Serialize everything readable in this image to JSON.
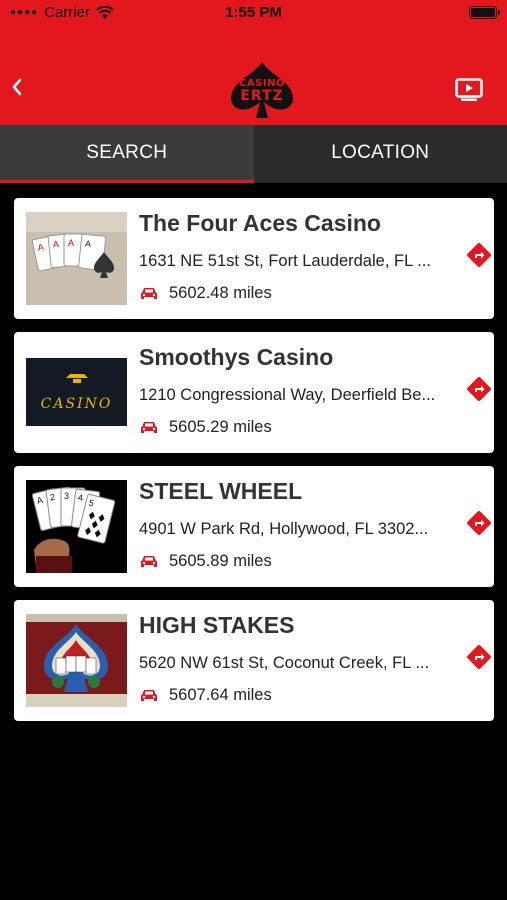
{
  "status_bar": {
    "carrier": "Carrier",
    "time": "1:55 PM"
  },
  "header": {
    "logo_line1": "CASINO",
    "logo_line2": "ERTZ",
    "back_icon": "chevron-left-icon",
    "right_icon": "tv-play-icon"
  },
  "tabs": [
    {
      "label": "SEARCH",
      "active": true
    },
    {
      "label": "LOCATION",
      "active": false
    }
  ],
  "casinos": [
    {
      "name": "The Four Aces Casino",
      "address": "1631 NE 51st St, Fort Lauderdale, FL ...",
      "distance": "5602.48 miles"
    },
    {
      "name": "Smoothys Casino",
      "address": "1210 Congressional Way, Deerfield Be...",
      "distance": "5605.29 miles",
      "thumb_text": "CASINO"
    },
    {
      "name": "STEEL WHEEL",
      "address": "4901 W Park Rd, Hollywood, FL 3302...",
      "distance": "5605.89 miles"
    },
    {
      "name": "HIGH STAKES",
      "address": "5620 NW 61st St, Coconut Creek, FL ...",
      "distance": "5607.64 miles"
    }
  ],
  "colors": {
    "accent": "#e3181f",
    "background": "#000000",
    "tab_active": "#3a3a3a",
    "tab_inactive": "#2b2b2b"
  }
}
